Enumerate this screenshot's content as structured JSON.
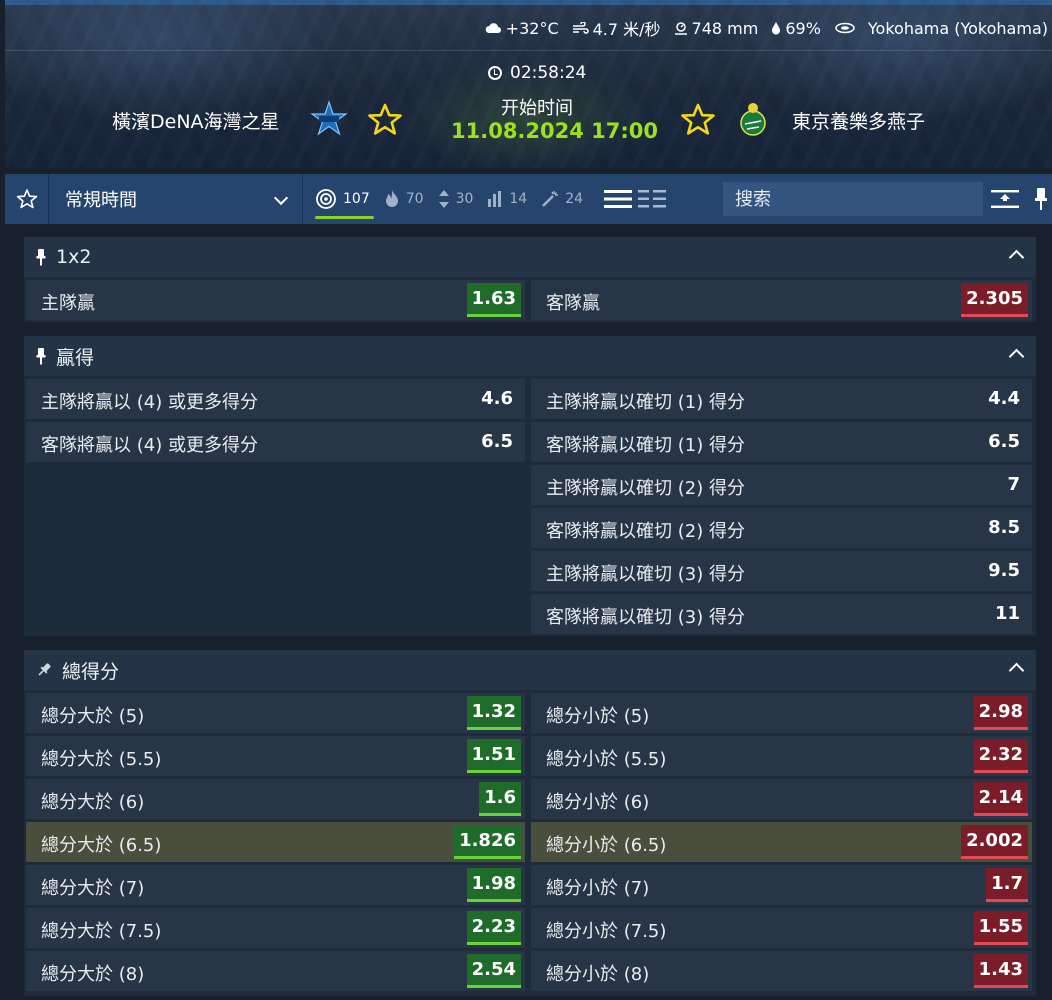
{
  "header": {
    "weather": {
      "temperature": "+32°C",
      "wind": "4.7 米/秒",
      "pressure": "748 mm",
      "humidity": "69%",
      "venue": "Yokohama (Yokohama)"
    },
    "countdown": "02:58:24",
    "start_label": "开始时间",
    "start_time": "11.08.2024 17:00",
    "home_team": "橫濱DeNA海灣之星",
    "away_team": "東京養樂多燕子"
  },
  "toolbar": {
    "period": "常規時間",
    "filters": [
      {
        "icon": "target-icon",
        "count": "107"
      },
      {
        "icon": "flame-icon",
        "count": "70"
      },
      {
        "icon": "up-down-arrows-icon",
        "count": "30"
      },
      {
        "icon": "bar-chart-icon",
        "count": "14"
      },
      {
        "icon": "magic-wand-icon",
        "count": "24"
      }
    ],
    "search_placeholder": "搜索"
  },
  "markets": {
    "m1x2": {
      "title": "1x2",
      "home": {
        "label": "主隊贏",
        "odd": "1.63"
      },
      "away": {
        "label": "客隊贏",
        "odd": "2.305"
      }
    },
    "winmargin": {
      "title": "贏得",
      "left": [
        {
          "label": "主隊將贏以 (4) 或更多得分",
          "odd": "4.6"
        },
        {
          "label": "客隊將贏以 (4) 或更多得分",
          "odd": "6.5"
        }
      ],
      "right": [
        {
          "label": "主隊將贏以確切 (1) 得分",
          "odd": "4.4"
        },
        {
          "label": "客隊將贏以確切 (1) 得分",
          "odd": "6.5"
        },
        {
          "label": "主隊將贏以確切 (2) 得分",
          "odd": "7"
        },
        {
          "label": "客隊將贏以確切 (2) 得分",
          "odd": "8.5"
        },
        {
          "label": "主隊將贏以確切 (3) 得分",
          "odd": "9.5"
        },
        {
          "label": "客隊將贏以確切 (3) 得分",
          "odd": "11"
        }
      ]
    },
    "totals": {
      "title": "總得分",
      "over": [
        {
          "label": "總分大於 (5)",
          "odd": "1.32"
        },
        {
          "label": "總分大於 (5.5)",
          "odd": "1.51"
        },
        {
          "label": "總分大於 (6)",
          "odd": "1.6"
        },
        {
          "label": "總分大於 (6.5)",
          "odd": "1.826"
        },
        {
          "label": "總分大於 (7)",
          "odd": "1.98"
        },
        {
          "label": "總分大於 (7.5)",
          "odd": "2.23"
        },
        {
          "label": "總分大於 (8)",
          "odd": "2.54"
        }
      ],
      "under": [
        {
          "label": "總分小於 (5)",
          "odd": "2.98"
        },
        {
          "label": "總分小於 (5.5)",
          "odd": "2.32"
        },
        {
          "label": "總分小於 (6)",
          "odd": "2.14"
        },
        {
          "label": "總分小於 (6.5)",
          "odd": "2.002"
        },
        {
          "label": "總分小於 (7)",
          "odd": "1.7"
        },
        {
          "label": "總分小於 (7.5)",
          "odd": "1.55"
        },
        {
          "label": "總分小於 (8)",
          "odd": "1.43"
        }
      ]
    }
  },
  "colors": {
    "odds_up": "#1e6b2a",
    "odds_down": "#7a1d28",
    "accent": "#9be21c",
    "toolbar": "#25456e"
  }
}
